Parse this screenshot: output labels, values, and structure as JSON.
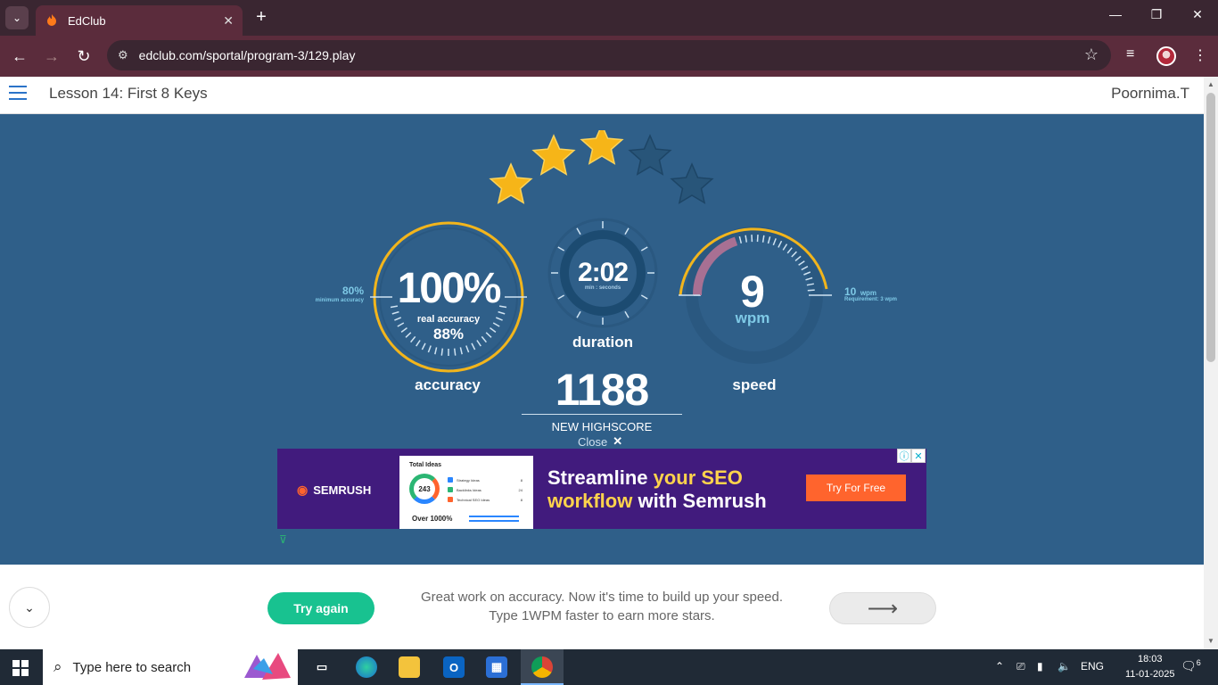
{
  "browser": {
    "tab_title": "EdClub",
    "url": "edclub.com/sportal/program-3/129.play",
    "colors": {
      "frame": "#3a2631",
      "toolbar": "#5b2c3c"
    }
  },
  "lesson": {
    "title": "Lesson 14: First 8 Keys",
    "user": "Poornima.T"
  },
  "results": {
    "stars": {
      "earned": 3,
      "total": 5
    },
    "accuracy": {
      "value": "100%",
      "real_label": "real accuracy",
      "real_value": "88%",
      "label": "accuracy",
      "min_value": "80%",
      "min_label": "minimum accuracy"
    },
    "duration": {
      "value": "2:02",
      "unit": "min : seconds",
      "label": "duration"
    },
    "speed": {
      "value": "9",
      "unit": "wpm",
      "label": "speed",
      "req_value": "10",
      "req_unit": "wpm",
      "req_label": "Requirement: 3 wpm"
    },
    "score": {
      "value": "1188",
      "label": "NEW HIGHSCORE",
      "close_label": "Close"
    }
  },
  "ad": {
    "brand": "SEMRUSH",
    "card_title": "Total Ideas",
    "card_count": "243",
    "card_rows": [
      "Strategy Ideas",
      "Backlinks Ideas",
      "Technical SEO Ideas"
    ],
    "card_row_values": [
      "8",
      "24",
      "8"
    ],
    "card_footer": "Over 1000%",
    "headline_1a": "Streamline ",
    "headline_1b": "your SEO",
    "headline_2a": "workflow",
    "headline_2b": " with Semrush",
    "cta": "Try For Free"
  },
  "footer": {
    "try_again": "Try again",
    "message_line1": "Great work on accuracy. Now it's time to build up your speed.",
    "message_line2": "Type 1WPM faster to earn more stars."
  },
  "taskbar": {
    "search_placeholder": "Type here to search",
    "lang": "ENG",
    "time": "18:03",
    "date": "11-01-2025",
    "notifications": "6"
  },
  "colors": {
    "stage": "#2f5f89",
    "gold": "#f2b51c",
    "try_again": "#18c290",
    "ad_bg": "#411b7d",
    "ad_cta": "#ff642d"
  }
}
